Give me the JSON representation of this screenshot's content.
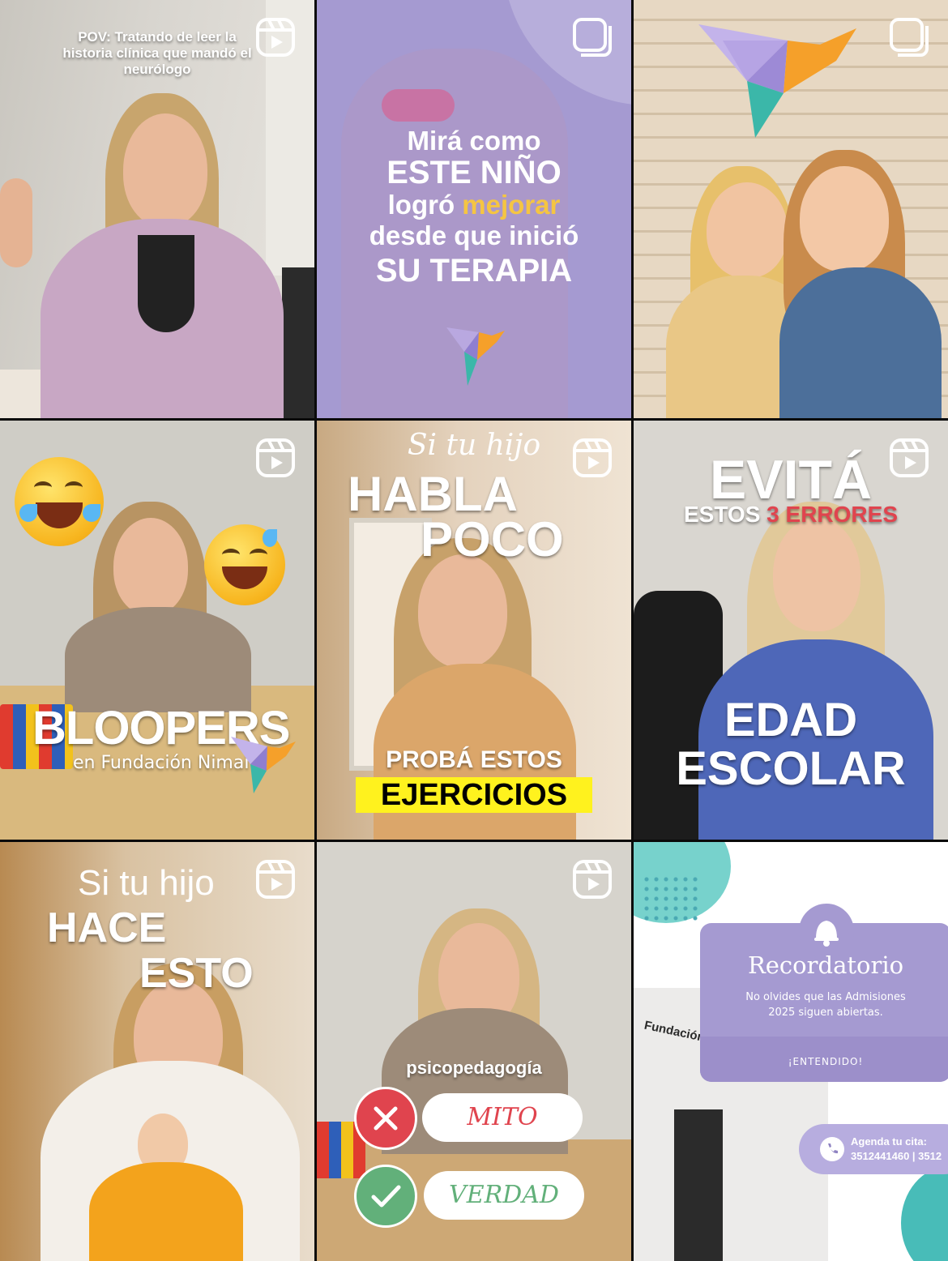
{
  "posts": [
    {
      "type": "reel",
      "caption_lines": [
        "POV: Tratando de leer la",
        "historia clínica que mandó el",
        "neurólogo"
      ]
    },
    {
      "type": "carousel",
      "lines": {
        "l1": "Mirá como",
        "l2": "ESTE NIÑO",
        "l3a": "logró ",
        "l3b": "mejorar",
        "l4": "desde que inició",
        "l5": "SU TERAPIA"
      }
    },
    {
      "type": "carousel"
    },
    {
      "type": "reel",
      "title": "BLOOPERS",
      "subtitle": "en Fundación Nimai"
    },
    {
      "type": "reel",
      "top": "Si tu hijo",
      "big1": "HABLA",
      "big2": "POCO",
      "bottom1": "PROBÁ ESTOS",
      "bottom2": "EJERCICIOS"
    },
    {
      "type": "reel",
      "big": "EVITÁ",
      "sub_a": "ESTOS ",
      "sub_b": "3",
      "sub_c": " ERRORES",
      "bottom1": "EDAD",
      "bottom2": "ESCOLAR"
    },
    {
      "type": "reel",
      "top": "Si tu hijo",
      "big1": "HACE",
      "big2": "ESTO"
    },
    {
      "type": "reel",
      "label": "psicopedagogía",
      "option1": "MITO",
      "option2": "VERDAD"
    },
    {
      "type": "image",
      "card_title": "Recordatorio",
      "card_text": [
        "No olvides que las Admisiones",
        "2025 siguen abiertas."
      ],
      "card_button": "¡ENTENDIDO!",
      "sign": "Fundación Nimai",
      "contact_title": "Agenda tu cita:",
      "contact_numbers": "3512441460 | 3512"
    }
  ],
  "icons": {
    "reel": "reels-icon",
    "carousel": "carousel-icon"
  },
  "colors": {
    "lavender": "#a59ad1",
    "yellow": "#f5c542",
    "highlight": "#fff21e",
    "red": "#e0444e",
    "green": "#62b07a",
    "teal": "#34b5b0"
  }
}
